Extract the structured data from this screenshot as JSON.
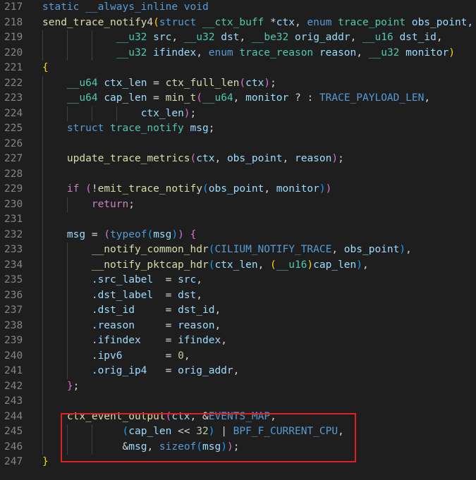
{
  "editor": {
    "lines": [
      {
        "num": "217",
        "tokens": [
          {
            "t": "static ",
            "c": "kw"
          },
          {
            "t": "__always_inline ",
            "c": "kw"
          },
          {
            "t": "void",
            "c": "kw"
          }
        ]
      },
      {
        "num": "218",
        "tokens": [
          {
            "t": "send_trace_notify4",
            "c": "fn"
          },
          {
            "t": "(",
            "c": "brk"
          },
          {
            "t": "struct ",
            "c": "kw"
          },
          {
            "t": "__ctx_buff ",
            "c": "ty"
          },
          {
            "t": "*",
            "c": "op"
          },
          {
            "t": "ctx",
            "c": "var"
          },
          {
            "t": ", ",
            "c": "plain"
          },
          {
            "t": "enum ",
            "c": "kw"
          },
          {
            "t": "trace_point ",
            "c": "ty"
          },
          {
            "t": "obs_point,",
            "c": "var"
          }
        ]
      },
      {
        "num": "219",
        "tokens": [
          {
            "t": "            ",
            "c": "plain"
          },
          {
            "t": "__u32 ",
            "c": "ty"
          },
          {
            "t": "src",
            "c": "var"
          },
          {
            "t": ", ",
            "c": "plain"
          },
          {
            "t": "__u32 ",
            "c": "ty"
          },
          {
            "t": "dst",
            "c": "var"
          },
          {
            "t": ", ",
            "c": "plain"
          },
          {
            "t": "__be32 ",
            "c": "ty"
          },
          {
            "t": "orig_addr",
            "c": "var"
          },
          {
            "t": ", ",
            "c": "plain"
          },
          {
            "t": "__u16 ",
            "c": "ty"
          },
          {
            "t": "dst_id",
            "c": "var"
          },
          {
            "t": ",",
            "c": "plain"
          }
        ]
      },
      {
        "num": "220",
        "tokens": [
          {
            "t": "            ",
            "c": "plain"
          },
          {
            "t": "__u32 ",
            "c": "ty"
          },
          {
            "t": "ifindex",
            "c": "var"
          },
          {
            "t": ", ",
            "c": "plain"
          },
          {
            "t": "enum ",
            "c": "kw"
          },
          {
            "t": "trace_reason ",
            "c": "ty"
          },
          {
            "t": "reason",
            "c": "var"
          },
          {
            "t": ", ",
            "c": "plain"
          },
          {
            "t": "__u32 ",
            "c": "ty"
          },
          {
            "t": "monitor",
            "c": "var"
          },
          {
            "t": ")",
            "c": "brk"
          }
        ]
      },
      {
        "num": "221",
        "tokens": [
          {
            "t": "{",
            "c": "brk"
          }
        ]
      },
      {
        "num": "222",
        "tokens": [
          {
            "t": "    ",
            "c": "plain"
          },
          {
            "t": "__u64 ",
            "c": "ty"
          },
          {
            "t": "ctx_len",
            "c": "var"
          },
          {
            "t": " = ",
            "c": "op"
          },
          {
            "t": "ctx_full_len",
            "c": "fn"
          },
          {
            "t": "(",
            "c": "brk2"
          },
          {
            "t": "ctx",
            "c": "var"
          },
          {
            "t": ")",
            "c": "brk2"
          },
          {
            "t": ";",
            "c": "plain"
          }
        ]
      },
      {
        "num": "223",
        "tokens": [
          {
            "t": "    ",
            "c": "plain"
          },
          {
            "t": "__u64 ",
            "c": "ty"
          },
          {
            "t": "cap_len",
            "c": "var"
          },
          {
            "t": " = ",
            "c": "op"
          },
          {
            "t": "min_t",
            "c": "fn"
          },
          {
            "t": "(",
            "c": "brk2"
          },
          {
            "t": "__u64",
            "c": "ty"
          },
          {
            "t": ", ",
            "c": "plain"
          },
          {
            "t": "monitor",
            "c": "var"
          },
          {
            "t": " ? : ",
            "c": "op"
          },
          {
            "t": "TRACE_PAYLOAD_LEN",
            "c": "mac"
          },
          {
            "t": ",",
            "c": "plain"
          }
        ]
      },
      {
        "num": "224",
        "tokens": [
          {
            "t": "                ",
            "c": "plain"
          },
          {
            "t": "ctx_len",
            "c": "var"
          },
          {
            "t": ")",
            "c": "brk2"
          },
          {
            "t": ";",
            "c": "plain"
          }
        ]
      },
      {
        "num": "225",
        "tokens": [
          {
            "t": "    ",
            "c": "plain"
          },
          {
            "t": "struct ",
            "c": "kw"
          },
          {
            "t": "trace_notify ",
            "c": "ty"
          },
          {
            "t": "msg",
            "c": "var"
          },
          {
            "t": ";",
            "c": "plain"
          }
        ]
      },
      {
        "num": "226",
        "tokens": []
      },
      {
        "num": "227",
        "tokens": [
          {
            "t": "    ",
            "c": "plain"
          },
          {
            "t": "update_trace_metrics",
            "c": "fn"
          },
          {
            "t": "(",
            "c": "brk2"
          },
          {
            "t": "ctx",
            "c": "var"
          },
          {
            "t": ", ",
            "c": "plain"
          },
          {
            "t": "obs_point",
            "c": "var"
          },
          {
            "t": ", ",
            "c": "plain"
          },
          {
            "t": "reason",
            "c": "var"
          },
          {
            "t": ")",
            "c": "brk2"
          },
          {
            "t": ";",
            "c": "plain"
          }
        ]
      },
      {
        "num": "228",
        "tokens": []
      },
      {
        "num": "229",
        "tokens": [
          {
            "t": "    ",
            "c": "plain"
          },
          {
            "t": "if ",
            "c": "ctl"
          },
          {
            "t": "(",
            "c": "brk2"
          },
          {
            "t": "!",
            "c": "op"
          },
          {
            "t": "emit_trace_notify",
            "c": "fn"
          },
          {
            "t": "(",
            "c": "brk3"
          },
          {
            "t": "obs_point",
            "c": "var"
          },
          {
            "t": ", ",
            "c": "plain"
          },
          {
            "t": "monitor",
            "c": "var"
          },
          {
            "t": ")",
            "c": "brk3"
          },
          {
            "t": ")",
            "c": "brk2"
          }
        ]
      },
      {
        "num": "230",
        "tokens": [
          {
            "t": "        ",
            "c": "plain"
          },
          {
            "t": "return",
            "c": "ctl"
          },
          {
            "t": ";",
            "c": "plain"
          }
        ]
      },
      {
        "num": "231",
        "tokens": []
      },
      {
        "num": "232",
        "tokens": [
          {
            "t": "    ",
            "c": "plain"
          },
          {
            "t": "msg",
            "c": "var"
          },
          {
            "t": " = ",
            "c": "op"
          },
          {
            "t": "(",
            "c": "brk2"
          },
          {
            "t": "typeof",
            "c": "kw"
          },
          {
            "t": "(",
            "c": "brk3"
          },
          {
            "t": "msg",
            "c": "var"
          },
          {
            "t": ")",
            "c": "brk3"
          },
          {
            "t": ")",
            "c": "brk2"
          },
          {
            "t": " ",
            "c": "plain"
          },
          {
            "t": "{",
            "c": "brk2"
          }
        ]
      },
      {
        "num": "233",
        "tokens": [
          {
            "t": "        ",
            "c": "plain"
          },
          {
            "t": "__notify_common_hdr",
            "c": "fn"
          },
          {
            "t": "(",
            "c": "brk3"
          },
          {
            "t": "CILIUM_NOTIFY_TRACE",
            "c": "mac"
          },
          {
            "t": ", ",
            "c": "plain"
          },
          {
            "t": "obs_point",
            "c": "var"
          },
          {
            "t": ")",
            "c": "brk3"
          },
          {
            "t": ",",
            "c": "plain"
          }
        ]
      },
      {
        "num": "234",
        "tokens": [
          {
            "t": "        ",
            "c": "plain"
          },
          {
            "t": "__notify_pktcap_hdr",
            "c": "fn"
          },
          {
            "t": "(",
            "c": "brk3"
          },
          {
            "t": "ctx_len",
            "c": "var"
          },
          {
            "t": ", ",
            "c": "plain"
          },
          {
            "t": "(",
            "c": "brk"
          },
          {
            "t": "__u16",
            "c": "ty"
          },
          {
            "t": ")",
            "c": "brk"
          },
          {
            "t": "cap_len",
            "c": "var"
          },
          {
            "t": ")",
            "c": "brk3"
          },
          {
            "t": ",",
            "c": "plain"
          }
        ]
      },
      {
        "num": "235",
        "tokens": [
          {
            "t": "        ",
            "c": "plain"
          },
          {
            "t": ".src_label",
            "c": "var"
          },
          {
            "t": "  = ",
            "c": "op"
          },
          {
            "t": "src",
            "c": "var"
          },
          {
            "t": ",",
            "c": "plain"
          }
        ]
      },
      {
        "num": "236",
        "tokens": [
          {
            "t": "        ",
            "c": "plain"
          },
          {
            "t": ".dst_label",
            "c": "var"
          },
          {
            "t": "  = ",
            "c": "op"
          },
          {
            "t": "dst",
            "c": "var"
          },
          {
            "t": ",",
            "c": "plain"
          }
        ]
      },
      {
        "num": "237",
        "tokens": [
          {
            "t": "        ",
            "c": "plain"
          },
          {
            "t": ".dst_id",
            "c": "var"
          },
          {
            "t": "     = ",
            "c": "op"
          },
          {
            "t": "dst_id",
            "c": "var"
          },
          {
            "t": ",",
            "c": "plain"
          }
        ]
      },
      {
        "num": "238",
        "tokens": [
          {
            "t": "        ",
            "c": "plain"
          },
          {
            "t": ".reason",
            "c": "var"
          },
          {
            "t": "     = ",
            "c": "op"
          },
          {
            "t": "reason",
            "c": "var"
          },
          {
            "t": ",",
            "c": "plain"
          }
        ]
      },
      {
        "num": "239",
        "tokens": [
          {
            "t": "        ",
            "c": "plain"
          },
          {
            "t": ".ifindex",
            "c": "var"
          },
          {
            "t": "    = ",
            "c": "op"
          },
          {
            "t": "ifindex",
            "c": "var"
          },
          {
            "t": ",",
            "c": "plain"
          }
        ]
      },
      {
        "num": "240",
        "tokens": [
          {
            "t": "        ",
            "c": "plain"
          },
          {
            "t": ".ipv6",
            "c": "var"
          },
          {
            "t": "       = ",
            "c": "op"
          },
          {
            "t": "0",
            "c": "num"
          },
          {
            "t": ",",
            "c": "plain"
          }
        ]
      },
      {
        "num": "241",
        "tokens": [
          {
            "t": "        ",
            "c": "plain"
          },
          {
            "t": ".orig_ip4",
            "c": "var"
          },
          {
            "t": "   = ",
            "c": "op"
          },
          {
            "t": "orig_addr",
            "c": "var"
          },
          {
            "t": ",",
            "c": "plain"
          }
        ]
      },
      {
        "num": "242",
        "tokens": [
          {
            "t": "    ",
            "c": "plain"
          },
          {
            "t": "}",
            "c": "brk2"
          },
          {
            "t": ";",
            "c": "plain"
          }
        ]
      },
      {
        "num": "243",
        "tokens": []
      },
      {
        "num": "244",
        "tokens": [
          {
            "t": "    ",
            "c": "plain"
          },
          {
            "t": "ctx_event_output",
            "c": "fn"
          },
          {
            "t": "(",
            "c": "brk2"
          },
          {
            "t": "ctx",
            "c": "var"
          },
          {
            "t": ", ",
            "c": "plain"
          },
          {
            "t": "&",
            "c": "op"
          },
          {
            "t": "EVENTS_MAP",
            "c": "mac"
          },
          {
            "t": ",",
            "c": "plain"
          }
        ]
      },
      {
        "num": "245",
        "tokens": [
          {
            "t": "             ",
            "c": "plain"
          },
          {
            "t": "(",
            "c": "brk3"
          },
          {
            "t": "cap_len",
            "c": "var"
          },
          {
            "t": " << ",
            "c": "op"
          },
          {
            "t": "32",
            "c": "num"
          },
          {
            "t": ")",
            "c": "brk3"
          },
          {
            "t": " | ",
            "c": "op"
          },
          {
            "t": "BPF_F_CURRENT_CPU",
            "c": "mac"
          },
          {
            "t": ",",
            "c": "plain"
          }
        ]
      },
      {
        "num": "246",
        "tokens": [
          {
            "t": "             ",
            "c": "plain"
          },
          {
            "t": "&",
            "c": "op"
          },
          {
            "t": "msg",
            "c": "var"
          },
          {
            "t": ", ",
            "c": "plain"
          },
          {
            "t": "sizeof",
            "c": "kw"
          },
          {
            "t": "(",
            "c": "brk3"
          },
          {
            "t": "msg",
            "c": "var"
          },
          {
            "t": ")",
            "c": "brk3"
          },
          {
            "t": ")",
            "c": "brk2"
          },
          {
            "t": ";",
            "c": "plain"
          }
        ]
      },
      {
        "num": "247",
        "tokens": [
          {
            "t": "}",
            "c": "brk"
          }
        ]
      }
    ]
  },
  "colors": {
    "background": "#1e1e1e",
    "line_number": "#858585",
    "highlight_border": "#e01f1f",
    "keyword": "#569cd6",
    "function": "#dcdcaa",
    "type": "#4ec9b0",
    "variable": "#9cdcfe",
    "number": "#b5cea8",
    "control": "#c586c0"
  }
}
